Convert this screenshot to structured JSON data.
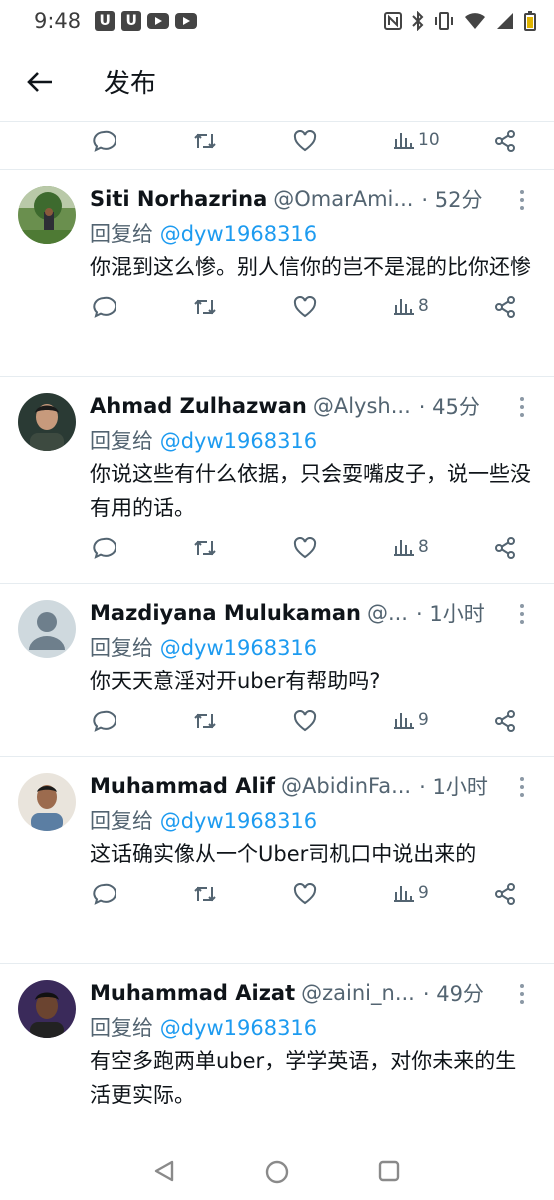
{
  "status_bar": {
    "time": "9:48",
    "left_icons": [
      "u-app-icon",
      "u-app-icon",
      "youtube-icon",
      "youtube-icon"
    ],
    "right_icons": [
      "nfc-icon",
      "bluetooth-icon",
      "vibrate-icon",
      "wifi-icon",
      "signal-icon",
      "battery-icon"
    ],
    "u_label": "U"
  },
  "header": {
    "title": "发布"
  },
  "top_actions": {
    "views": "10"
  },
  "tweets": [
    {
      "name": "Siti Norhazrina",
      "handle": "@OmarAmi...",
      "time": "· 52分",
      "reply_prefix": "回复给",
      "mention": "@dyw1968316",
      "text": "你混到这么惨。别人信你的岂不是混的比你还惨",
      "views": "8"
    },
    {
      "name": "Ahmad Zulhazwan",
      "handle": "@Alysh...",
      "time": "· 45分",
      "reply_prefix": "回复给",
      "mention": "@dyw1968316",
      "text": "你说这些有什么依据，只会耍嘴皮子，说一些没有用的话。",
      "views": "8"
    },
    {
      "name": "Mazdiyana Mulukaman",
      "handle": "@...",
      "time": "· 1小时",
      "reply_prefix": "回复给",
      "mention": "@dyw1968316",
      "text": "你天天意淫对开uber有帮助吗?",
      "views": "9"
    },
    {
      "name": "Muhammad Alif",
      "handle": "@AbidinFa...",
      "time": "· 1小时",
      "reply_prefix": "回复给",
      "mention": "@dyw1968316",
      "text": "这话确实像从一个Uber司机口中说出来的",
      "views": "9"
    },
    {
      "name": "Muhammad Aizat",
      "handle": "@zaini_n...",
      "time": "· 49分",
      "reply_prefix": "回复给",
      "mention": "@dyw1968316",
      "text": "有空多跑两单uber，学学英语，对你未来的生活更实际。",
      "views": ""
    }
  ],
  "colors": {
    "link": "#1d9bf0",
    "secondary": "#536471",
    "text": "#0f1419"
  }
}
